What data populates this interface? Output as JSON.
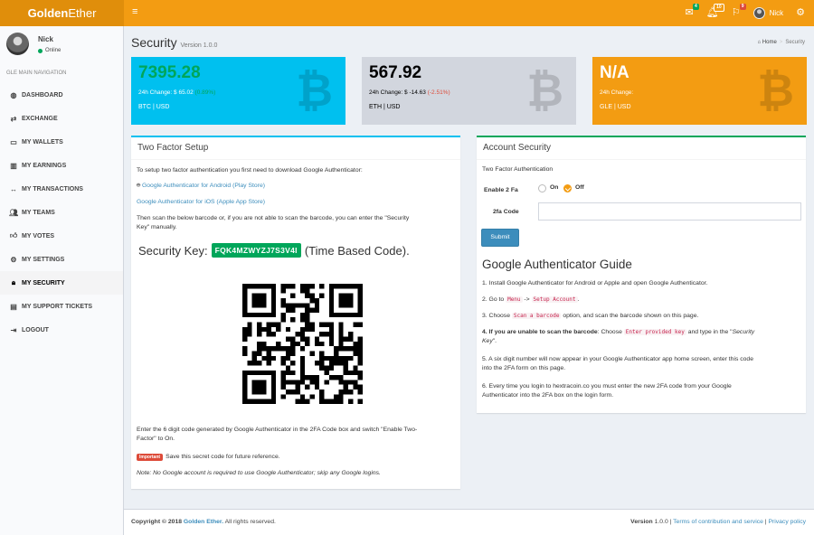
{
  "brand": {
    "bold": "Golden",
    "rest": "Ether"
  },
  "header": {
    "menu_icon": "hamburger-icon",
    "mail_badge": "4",
    "bell_badge": "10",
    "flag_badge": "9",
    "user_name": "Nick",
    "settings_icon": "gears-icon"
  },
  "sidebar": {
    "user_name": "Nick",
    "user_status": "Online",
    "nav_header": "GLE MAIN NAVIGATION",
    "items": [
      {
        "icon": "dashboard-icon",
        "label": "DASHBOARD"
      },
      {
        "icon": "exchange-icon",
        "label": "EXCHANGE"
      },
      {
        "icon": "wallet-icon",
        "label": "MY WALLETS"
      },
      {
        "icon": "bar-chart-icon",
        "label": "MY EARNINGS"
      },
      {
        "icon": "arrows-icon",
        "label": "MY TRANSACTIONS"
      },
      {
        "icon": "users-icon",
        "label": "MY TEAMS"
      },
      {
        "icon": "thumbs-up-icon",
        "label": "MY VOTES"
      },
      {
        "icon": "cogs-icon",
        "label": "MY SETTINGS"
      },
      {
        "icon": "lock-icon",
        "label": "MY SECURITY"
      },
      {
        "icon": "file-icon",
        "label": "MY SUPPORT TICKETS"
      },
      {
        "icon": "logout-icon",
        "label": "LOGOUT"
      }
    ],
    "active_index": 8
  },
  "page": {
    "title": "Security",
    "version": "Version 1.0.0",
    "breadcrumb_home": "Home",
    "breadcrumb_current": "Security"
  },
  "coins": [
    {
      "price": "7395.28",
      "change_prefix": "24h Change: $ 65.02",
      "change_pct": "(0.89%)",
      "pair": "BTC | USD"
    },
    {
      "price": "567.92",
      "change_prefix": "24h Change: $ -14.63",
      "change_pct": "(-2.51%)",
      "pair": "ETH | USD"
    },
    {
      "price": "N/A",
      "change_prefix": "24h Change:",
      "change_pct": "",
      "pair": "GLE | USD"
    }
  ],
  "two_factor": {
    "title": "Two Factor Setup",
    "intro": "To setup two factor authentication you first need to download Google Authenticator:",
    "android_link": "Google Authenticator for Android (Play Store)",
    "ios_link": "Google Authenticator for iOS (Apple App Store)",
    "scan_text_1": "Then scan the below barcode or, if you are not able to scan the barcode, you can enter the \"Security",
    "scan_text_2": "Key\" manually.",
    "security_key_label": "Security Key:",
    "security_key": "FQK4MZWYZJ7S3V4I",
    "time_based": "(Time Based Code).",
    "enter_code_1": "Enter the 6 digit code generated by Google Authenticator in the 2FA Code box and switch \"Enable Two-",
    "enter_code_2": "Factor\" to On.",
    "important_label": "Important",
    "important_text": "Save this secret code for future reference.",
    "note": "Note: No Google account is required to use Google Authenticator; skip any Google logins."
  },
  "account_security": {
    "title": "Account Security",
    "subtitle": "Two Factor Authentication",
    "enable_label": "Enable 2 Fa",
    "on_label": "On",
    "off_label": "Off",
    "selected": "Off",
    "code_label": "2fa Code",
    "code_value": "",
    "submit_label": "Submit"
  },
  "guide": {
    "title": "Google Authenticator Guide",
    "step1": "1. Install Google Authenticator for Android or Apple and open Google Authenticator.",
    "step2_a": "2. Go to",
    "step2_menu": "Menu",
    "step2_arrow": "->",
    "step2_setup": "Setup Account",
    "step2_end": ".",
    "step3_a": "3. Choose",
    "step3_code": "Scan a barcode",
    "step3_b": "option, and scan the barcode shown on this page.",
    "step4_bold": "4. If you are unable to scan the barcode",
    "step4_a": ": Choose",
    "step4_code": "Enter provided key",
    "step4_b": "and type in the \"",
    "step4_em1": "Security",
    "step4_em2": "Key",
    "step4_c": "\".",
    "step5_1": "5. A six digit number will now appear in your Google Authenticator app home screen, enter this code",
    "step5_2": "into the 2FA form on this page.",
    "step6_1": "6. Every time you login to hextracoin.co you must enter the new 2FA code from your Google",
    "step6_2": "Authenticator into the 2FA box on the login form."
  },
  "footer": {
    "copyright": "Copyright © 2018",
    "company": "Golden Ether.",
    "rights": "All rights reserved.",
    "version_label": "Version",
    "version": "1.0.0",
    "sep": "|",
    "terms": "Terms of contribution and service",
    "privacy": "Privacy policy"
  }
}
